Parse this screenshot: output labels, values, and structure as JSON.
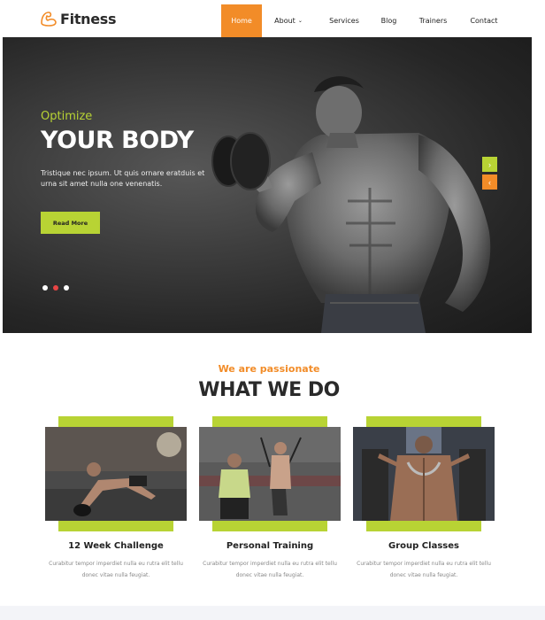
{
  "brand": {
    "name": "Fitness"
  },
  "nav": {
    "items": [
      {
        "label": "Home",
        "active": true
      },
      {
        "label": "About",
        "has_dropdown": true
      },
      {
        "label": "Services"
      },
      {
        "label": "Blog"
      },
      {
        "label": "Trainers"
      },
      {
        "label": "Contact"
      }
    ]
  },
  "hero": {
    "subtitle": "Optimize",
    "title": "YOUR BODY",
    "text": "Tristique nec ipsum. Ut quis ornare eratduis et urna sit amet nulla one venenatis.",
    "button_label": "Read More",
    "slides": 3,
    "active_slide": 2
  },
  "what_we_do": {
    "subtitle": "We are passionate",
    "title": "WHAT WE DO",
    "cards": [
      {
        "title": "12 Week Challenge",
        "text": "Curabitur tempor imperdiet nulla eu rutra elit tellu donec vitae nulla feugiat."
      },
      {
        "title": "Personal Training",
        "text": "Curabitur tempor imperdiet nulla eu rutra elit tellu donec vitae nulla feugiat."
      },
      {
        "title": "Group Classes",
        "text": "Curabitur tempor imperdiet nulla eu rutra elit tellu donec vitae nulla feugiat."
      }
    ]
  },
  "colors": {
    "accent_orange": "#f28c28",
    "accent_lime": "#b8d334",
    "hero_dark": "#262626"
  }
}
